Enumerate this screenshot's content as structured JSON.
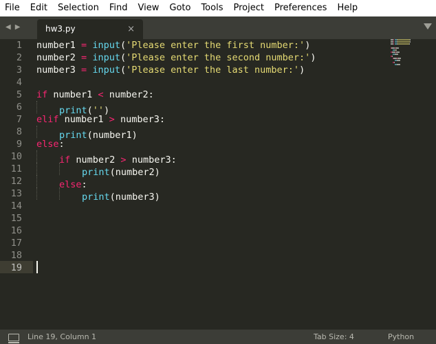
{
  "menu": [
    "File",
    "Edit",
    "Selection",
    "Find",
    "View",
    "Goto",
    "Tools",
    "Project",
    "Preferences",
    "Help"
  ],
  "tab": {
    "label": "hw3.py",
    "close": "×"
  },
  "nav": {
    "back": "◀",
    "forward": "▶"
  },
  "line_numbers": [
    "1",
    "2",
    "3",
    "4",
    "5",
    "6",
    "7",
    "8",
    "9",
    "10",
    "11",
    "12",
    "13",
    "14",
    "15",
    "16",
    "17",
    "18",
    "19"
  ],
  "code": [
    [
      {
        "t": "number1 ",
        "c": "tx"
      },
      {
        "t": "=",
        "c": "op"
      },
      {
        "t": " ",
        "c": "tx"
      },
      {
        "t": "input",
        "c": "fn"
      },
      {
        "t": "(",
        "c": "tx"
      },
      {
        "t": "'Please enter the first number:'",
        "c": "str"
      },
      {
        "t": ")",
        "c": "tx"
      }
    ],
    [
      {
        "t": "number2 ",
        "c": "tx"
      },
      {
        "t": "=",
        "c": "op"
      },
      {
        "t": " ",
        "c": "tx"
      },
      {
        "t": "input",
        "c": "fn"
      },
      {
        "t": "(",
        "c": "tx"
      },
      {
        "t": "'Please enter the second number:'",
        "c": "str"
      },
      {
        "t": ")",
        "c": "tx"
      }
    ],
    [
      {
        "t": "number3 ",
        "c": "tx"
      },
      {
        "t": "=",
        "c": "op"
      },
      {
        "t": " ",
        "c": "tx"
      },
      {
        "t": "input",
        "c": "fn"
      },
      {
        "t": "(",
        "c": "tx"
      },
      {
        "t": "'Please enter the last number:'",
        "c": "str"
      },
      {
        "t": ")",
        "c": "tx"
      }
    ],
    [],
    [
      {
        "t": "if",
        "c": "kw"
      },
      {
        "t": " number1 ",
        "c": "tx"
      },
      {
        "t": "<",
        "c": "op"
      },
      {
        "t": " number2:",
        "c": "tx"
      }
    ],
    [
      {
        "indent": 1
      },
      {
        "t": "print",
        "c": "fn"
      },
      {
        "t": "(",
        "c": "tx"
      },
      {
        "t": "''",
        "c": "str"
      },
      {
        "t": ")",
        "c": "tx"
      }
    ],
    [
      {
        "t": "elif",
        "c": "kw"
      },
      {
        "t": " number1 ",
        "c": "tx"
      },
      {
        "t": ">",
        "c": "op"
      },
      {
        "t": " number3:",
        "c": "tx"
      }
    ],
    [
      {
        "indent": 1
      },
      {
        "t": "print",
        "c": "fn"
      },
      {
        "t": "(number1)",
        "c": "tx"
      }
    ],
    [
      {
        "t": "else",
        "c": "kw"
      },
      {
        "t": ":",
        "c": "tx"
      }
    ],
    [
      {
        "indent": 1
      },
      {
        "t": "if",
        "c": "kw"
      },
      {
        "t": " number2 ",
        "c": "tx"
      },
      {
        "t": ">",
        "c": "op"
      },
      {
        "t": " number3:",
        "c": "tx"
      }
    ],
    [
      {
        "indent": 2
      },
      {
        "t": "print",
        "c": "fn"
      },
      {
        "t": "(number2)",
        "c": "tx"
      }
    ],
    [
      {
        "indent": 1
      },
      {
        "t": "else",
        "c": "kw"
      },
      {
        "t": ":",
        "c": "tx"
      }
    ],
    [
      {
        "indent": 2
      },
      {
        "t": "print",
        "c": "fn"
      },
      {
        "t": "(number3)",
        "c": "tx"
      }
    ],
    [],
    [],
    [],
    [],
    [],
    []
  ],
  "status": {
    "cursor": "Line 19, Column 1",
    "tab_size": "Tab Size: 4",
    "syntax": "Python"
  },
  "colors": {
    "background": "#272822",
    "keyword": "#f92672",
    "function": "#66d9ef",
    "string": "#e6db74",
    "text": "#f8f8f2"
  }
}
